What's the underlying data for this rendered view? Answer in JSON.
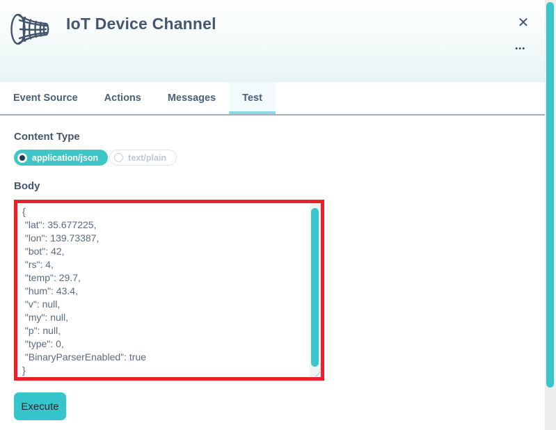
{
  "header": {
    "title": "IoT Device Channel",
    "icon": "horn-antenna-icon",
    "close_label": "✕",
    "menu_label": "•••"
  },
  "tabs": [
    {
      "label": "Event Source",
      "active": false
    },
    {
      "label": "Actions",
      "active": false
    },
    {
      "label": "Messages",
      "active": false
    },
    {
      "label": "Test",
      "active": true
    }
  ],
  "content_type": {
    "label": "Content Type",
    "options": [
      {
        "label": "application/json",
        "selected": true
      },
      {
        "label": "text/plain",
        "selected": false
      }
    ]
  },
  "body_section": {
    "label": "Body",
    "value": "{\n \"lat\": 35.677225,\n \"lon\": 139.73387,\n \"bot\": 42,\n \"rs\": 4,\n \"temp\": 29.7,\n \"hum\": 43.4,\n \"v\": null,\n \"my\": null,\n \"p\": null,\n \"type\": 0,\n \"BinaryParserEnabled\": true\n}"
  },
  "execute": {
    "label": "Execute"
  },
  "colors": {
    "accent_teal": "#3cc5c9",
    "highlight_border_red": "#ec2028",
    "slate_text": "#45566e",
    "active_tab_bg": "#f2fafb",
    "active_tab_underline": "#87dbe0"
  }
}
